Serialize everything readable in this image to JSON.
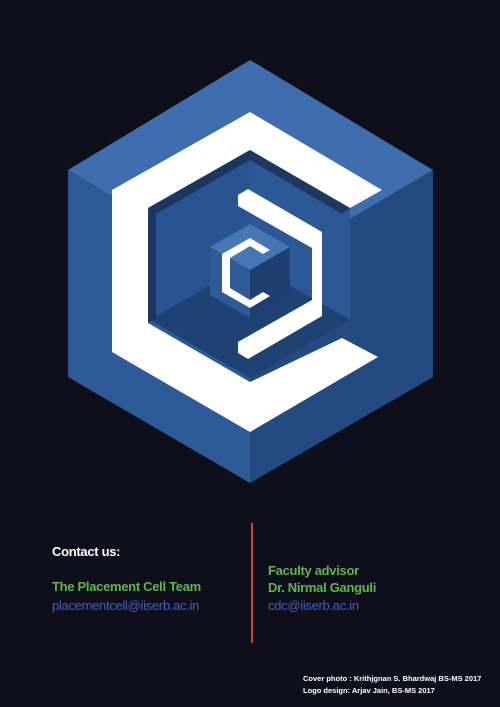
{
  "logo": {
    "description_icon": "hexagon-c-logo-icon",
    "colors": {
      "light_face": "#3e6ead",
      "mid_face": "#2f5a98",
      "dark_face": "#244a82",
      "deep_face": "#1e3f70",
      "c_white": "#ffffff",
      "shadow": "#13243f"
    }
  },
  "contact": {
    "title": "Contact us:",
    "team_name": "The Placement Cell Team",
    "team_email": "placementcell@iiserb.ac.in"
  },
  "faculty": {
    "role": "Faculty advisor",
    "name": "Dr. Nirmal Ganguli",
    "email": "cdc@iiserb.ac.in"
  },
  "credits": {
    "cover_photo": "Cover photo : Krithjgnan S. Bhardwaj BS-MS 2017",
    "logo_design": "Logo design: Arjav Jain, BS-MS 2017"
  },
  "colors": {
    "background": "#0f0f1c",
    "green": "#5fb64a",
    "email_blue": "#3d4fb5",
    "divider_red": "#c9453a",
    "white": "#ffffff"
  }
}
